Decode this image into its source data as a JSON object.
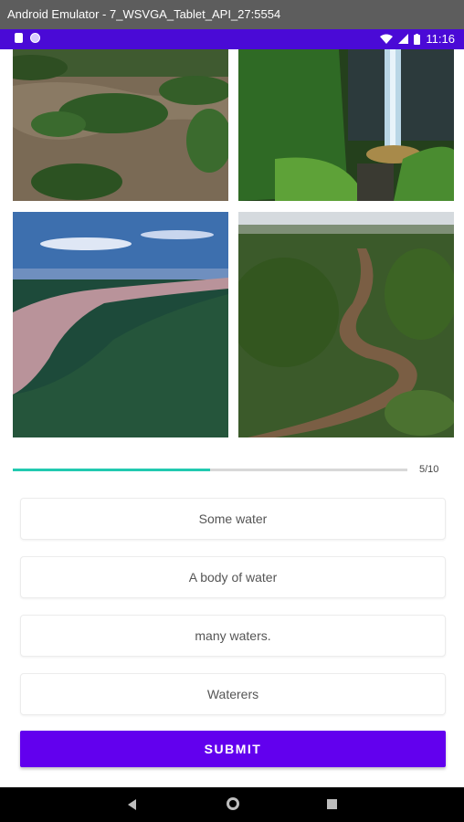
{
  "window": {
    "title": "Android Emulator - 7_WSVGA_Tablet_API_27:5554"
  },
  "status_bar": {
    "time": "11:16",
    "color": "#4a0ad6"
  },
  "images": [
    {
      "icon": "image-river-islands"
    },
    {
      "icon": "image-waterfall"
    },
    {
      "icon": "image-wide-river-aerial"
    },
    {
      "icon": "image-winding-river"
    }
  ],
  "progress": {
    "current": 5,
    "total": 10,
    "fraction": 0.5,
    "label": "5/10",
    "color": "#22c9b0"
  },
  "options": [
    {
      "label": "Some water"
    },
    {
      "label": "A body of water"
    },
    {
      "label": "many waters."
    },
    {
      "label": "Waterers"
    }
  ],
  "submit": {
    "label": "SUBMIT",
    "color": "#6200ee"
  }
}
